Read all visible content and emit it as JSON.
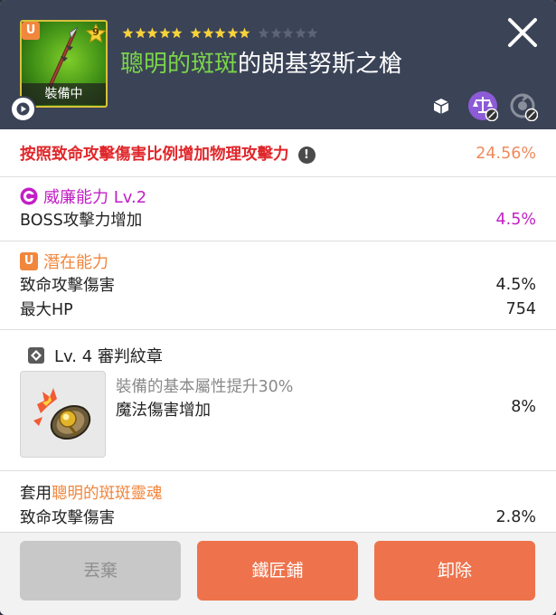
{
  "item": {
    "rarity_badge": "U",
    "star_force_badge": "9",
    "equipped_label": "裝備中",
    "stars_filled": 10,
    "stars_total": 15,
    "name_highlight": "聰明的斑斑",
    "name_rest": "的朗基努斯之槍"
  },
  "header_icons": [
    "trade-icon",
    "scale-blocked-icon",
    "transfer-blocked-icon"
  ],
  "special_option": {
    "label": "按照致命攻擊傷害比例增加物理攻擊力",
    "info_badge": "!",
    "value": "24.56%"
  },
  "soul_weapon": {
    "title": "威廉能力 Lv.2",
    "stats": [
      {
        "label": "BOSS攻擊力增加",
        "value": "4.5%"
      }
    ]
  },
  "potential": {
    "badge": "U",
    "title": "潛在能力",
    "stats": [
      {
        "label": "致命攻擊傷害",
        "value": "4.5%"
      },
      {
        "label": "最大HP",
        "value": "754"
      }
    ]
  },
  "emblem": {
    "title": "Lv. 4 審判紋章",
    "description": "裝備的基本屬性提升30%",
    "stat_label": "魔法傷害增加",
    "stat_value": "8%"
  },
  "set_effect": {
    "prefix": "套用",
    "name": "聰明的斑斑靈魂",
    "stats": [
      {
        "label": "致命攻擊傷害",
        "value": "2.8%"
      }
    ]
  },
  "buttons": {
    "discard": "丟棄",
    "blacksmith": "鐵匠鋪",
    "unequip": "卸除"
  },
  "colors": {
    "header_bg": "#3b4357",
    "accent_orange": "#ee734c",
    "special_red": "#e0272b",
    "soul_magenta": "#c21fc6",
    "potential_orange": "#f1863d",
    "name_green": "#7bd54a"
  }
}
